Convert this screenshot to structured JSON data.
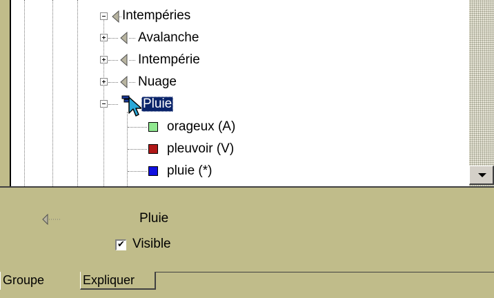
{
  "tree": {
    "nodes": [
      {
        "label": "Intempéries",
        "expander": "minus",
        "icon": "speaker-icon"
      },
      {
        "label": "Avalanche",
        "expander": "plus",
        "icon": "speaker-icon"
      },
      {
        "label": "Intempérie",
        "expander": "plus",
        "icon": "speaker-icon"
      },
      {
        "label": "Nuage",
        "expander": "plus",
        "icon": "speaker-icon"
      },
      {
        "label": "Pluie",
        "expander": "minus",
        "icon": "cursor-arrow-icon",
        "selected": true
      }
    ],
    "leaves": [
      {
        "label": "orageux (A)",
        "color": "#90e890"
      },
      {
        "label": "pleuvoir (V)",
        "color": "#b01818"
      },
      {
        "label": "pluie (*)",
        "color": "#1010e0"
      }
    ]
  },
  "details": {
    "name": "Pluie",
    "visible_label": "Visible",
    "visible_checked": true
  },
  "tabs": [
    {
      "label": "Groupe",
      "active": true
    },
    {
      "label": "Expliquer",
      "active": false
    }
  ],
  "colors": {
    "panel": "#c0bc8a",
    "selection": "#0a246a"
  }
}
